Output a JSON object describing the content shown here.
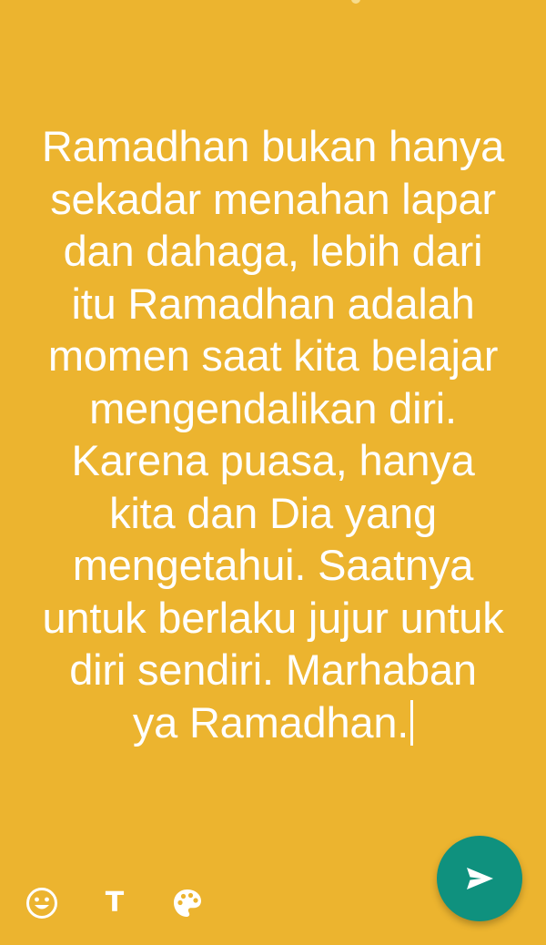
{
  "status_text": {
    "lines": [
      "Ramadhan bukan hanya",
      "sekadar menahan lapar",
      "dan dahaga, lebih dari",
      "itu Ramadhan adalah",
      "momen saat kita belajar",
      "mengendalikan diri.",
      "Karena puasa, hanya",
      "kita dan Dia yang",
      "mengetahui. Saatnya",
      "untuk berlaku jujur untuk",
      "diri sendiri. Marhaban",
      "ya Ramadhan."
    ]
  },
  "toolbar": {
    "emoji_icon": "smiley-face-icon",
    "text_label": "T",
    "palette_icon": "palette-icon",
    "send_icon": "send-arrow-icon"
  },
  "colors": {
    "background": "#ecb42f",
    "text": "#ffffff",
    "send_button": "#0f917e"
  }
}
